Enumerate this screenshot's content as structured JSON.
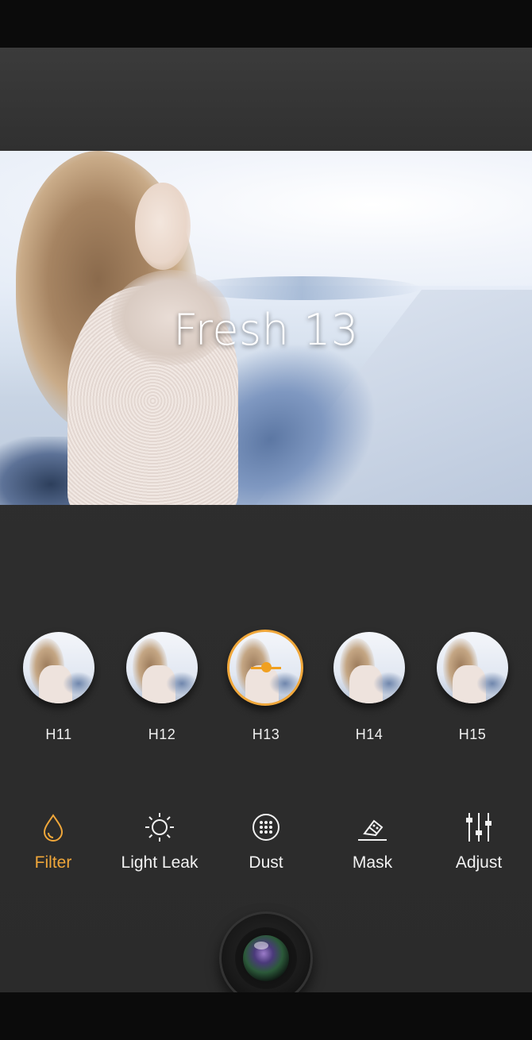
{
  "preview": {
    "caption": "Fresh 13"
  },
  "filters": [
    {
      "label": "H11",
      "selected": false
    },
    {
      "label": "H12",
      "selected": false
    },
    {
      "label": "H13",
      "selected": true
    },
    {
      "label": "H14",
      "selected": false
    },
    {
      "label": "H15",
      "selected": false
    }
  ],
  "tools": [
    {
      "label": "Filter",
      "icon": "drop-icon",
      "active": true
    },
    {
      "label": "Light Leak",
      "icon": "sun-icon",
      "active": false
    },
    {
      "label": "Dust",
      "icon": "dots-circle-icon",
      "active": false
    },
    {
      "label": "Mask",
      "icon": "eraser-icon",
      "active": false
    },
    {
      "label": "Adjust",
      "icon": "sliders-icon",
      "active": false
    }
  ],
  "colors": {
    "accent": "#f0a73a",
    "background": "#2b2b2b",
    "text": "#f2f2f2"
  },
  "shutter": {
    "icon": "camera-lens-icon"
  }
}
